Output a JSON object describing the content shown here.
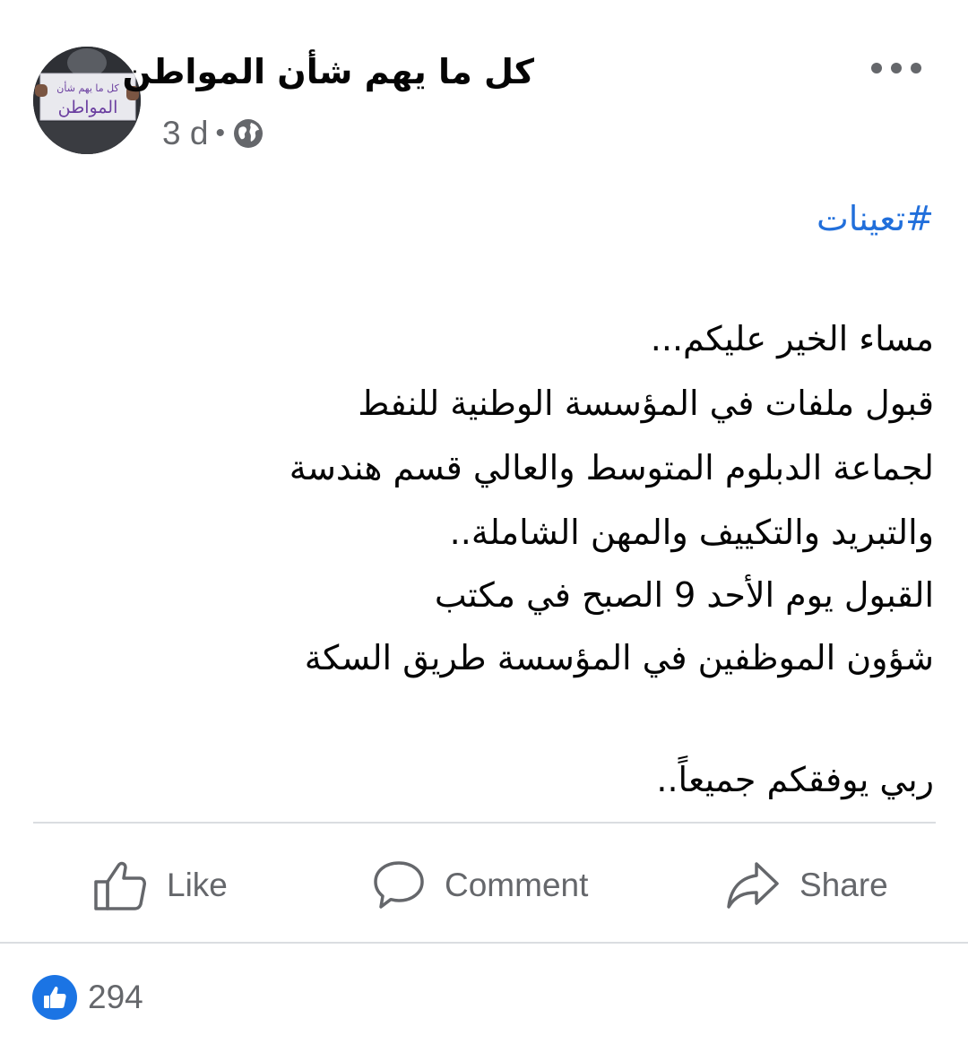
{
  "header": {
    "page_name": "كل ما يهم شأن المواطن",
    "timestamp": "3 d",
    "separator": "•",
    "privacy_icon": "globe-icon",
    "more_icon": "more-horizontal-icon",
    "avatar_sign_line1": "كل ما يهم شأن",
    "avatar_sign_line2": "المواطن"
  },
  "post": {
    "hashtag": "#تعينات",
    "lines": [
      "مساء الخير عليكم...",
      " قبول ملفات في المؤسسة الوطنية للنفط",
      "لجماعة الدبلوم المتوسط والعالي قسم هندسة",
      "والتبريد والتكييف والمهن الشاملة..",
      "القبول يوم الأحد 9 الصبح في مكتب",
      "شؤون الموظفين في المؤسسة طريق السكة"
    ],
    "closing": "ربي يوفقكم جميعاً.."
  },
  "actions": {
    "like_label": "Like",
    "comment_label": "Comment",
    "share_label": "Share"
  },
  "reactions": {
    "icon": "like-reaction-icon",
    "count": "294"
  },
  "colors": {
    "link_blue": "#216fdb",
    "like_blue": "#1b74e4",
    "secondary_text": "#65676b",
    "divider": "#dadde1"
  }
}
